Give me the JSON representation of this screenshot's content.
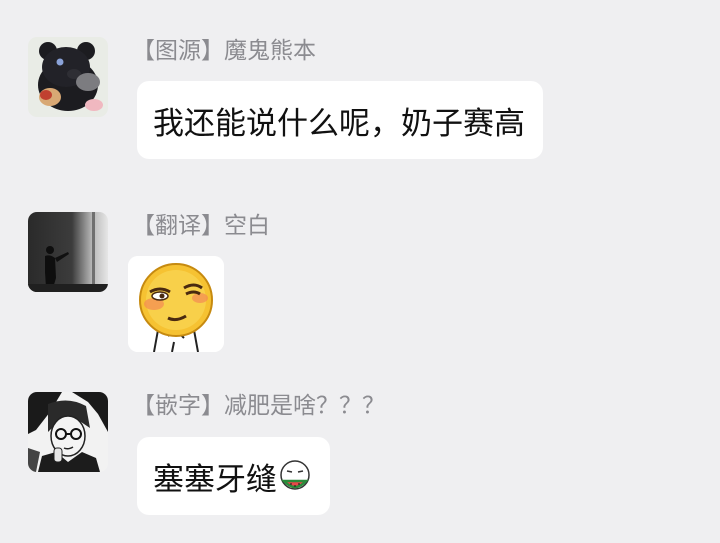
{
  "messages": [
    {
      "avatar_icon": "black-bear-avatar-icon",
      "sender": "【图源】魔鬼熊本",
      "text": "我还能说什么呢，奶子赛高"
    },
    {
      "avatar_icon": "dark-room-figure-avatar-icon",
      "sender": "【翻译】空白",
      "sticker_icon": "squinting-smiley-sticker-icon"
    },
    {
      "avatar_icon": "manga-glasses-character-avatar-icon",
      "sender": "【嵌字】减肥是啥？？？",
      "text": "塞塞牙缝",
      "emoji_icon": "eating-watermelon-emoji-icon"
    }
  ],
  "colors": {
    "background": "#efeff1",
    "bubble": "#ffffff",
    "sender_text": "#8b8b90",
    "message_text": "#111111"
  }
}
